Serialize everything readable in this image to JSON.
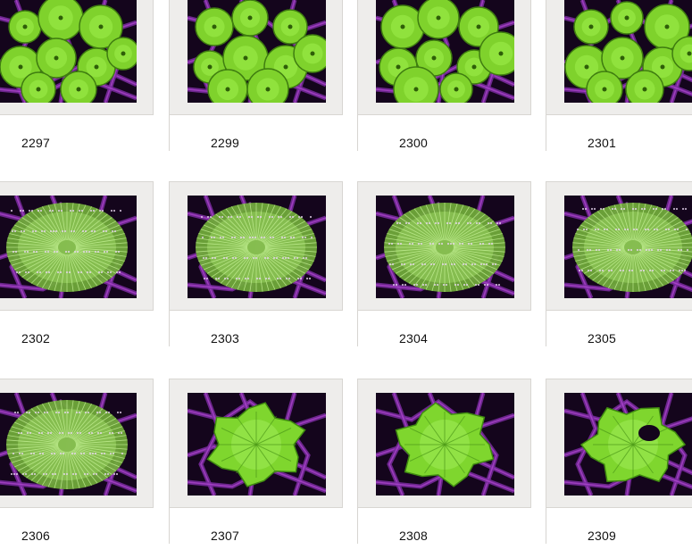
{
  "colors": {
    "frame_bg": "#eeedeb",
    "background_purple": "#6b1c8a",
    "coral_green": "#8ee63a"
  },
  "tiles": [
    {
      "label": "2297",
      "kind": "mushroom-cluster"
    },
    {
      "label": "2299",
      "kind": "mushroom-cluster"
    },
    {
      "label": "2300",
      "kind": "mushroom-cluster"
    },
    {
      "label": "2301",
      "kind": "mushroom-cluster"
    },
    {
      "label": "2302",
      "kind": "hairy-mushroom"
    },
    {
      "label": "2303",
      "kind": "hairy-mushroom"
    },
    {
      "label": "2304",
      "kind": "hairy-mushroom"
    },
    {
      "label": "2305",
      "kind": "hairy-mushroom"
    },
    {
      "label": "2306",
      "kind": "hairy-mushroom"
    },
    {
      "label": "2307",
      "kind": "leafy-mushroom"
    },
    {
      "label": "2308",
      "kind": "leafy-mushroom"
    },
    {
      "label": "2309",
      "kind": "leafy-mushroom"
    }
  ]
}
